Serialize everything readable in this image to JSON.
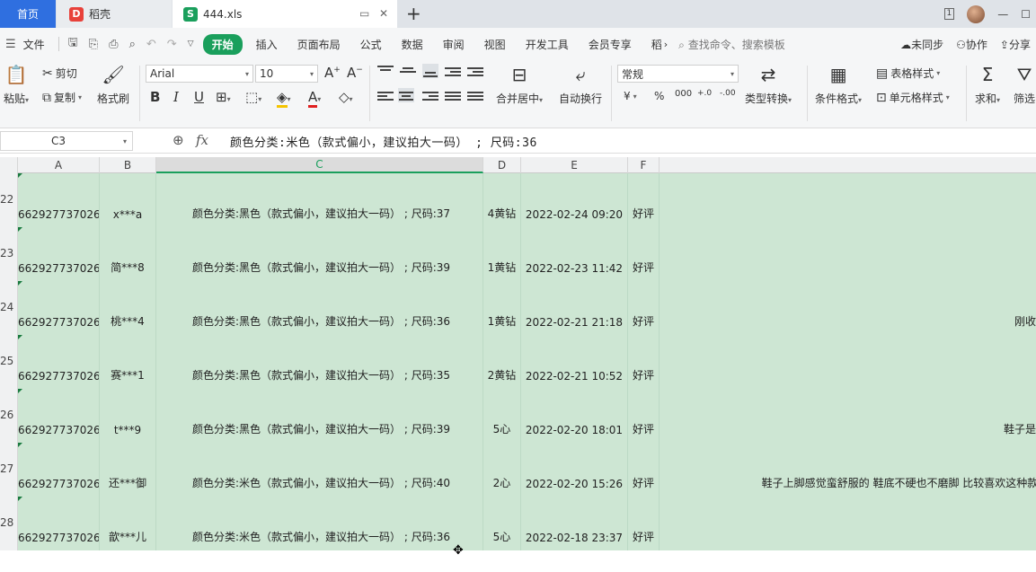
{
  "tabs": {
    "home": "首页",
    "daoke": "稻壳",
    "file": "444.xls",
    "daoke_icon": "D",
    "file_icon": "S"
  },
  "window": {
    "badge": "1"
  },
  "menu": {
    "file": "文件",
    "items": [
      "开始",
      "插入",
      "页面布局",
      "公式",
      "数据",
      "审阅",
      "视图",
      "开发工具",
      "会员专享",
      "稻"
    ],
    "search": "查找命令、搜索模板",
    "sync": "未同步",
    "collab": "协作",
    "share": "分享"
  },
  "ribbon": {
    "paste": "粘贴",
    "cut": "剪切",
    "copy": "复制",
    "format_painter": "格式刷",
    "font_name": "Arial",
    "font_size": "10",
    "merge_center": "合并居中",
    "wrap_text": "自动换行",
    "number_format": "常规",
    "type_convert": "类型转换",
    "conditional_format": "条件格式",
    "table_style": "表格样式",
    "cell_style": "单元格样式",
    "sum": "求和",
    "filter": "筛选",
    "bold": "B",
    "italic": "I",
    "underline": "U",
    "font_grow": "A",
    "font_shrink": "A",
    "currency": "¥",
    "percent": "%",
    "thousands": "000",
    "inc_decimal": "+.0",
    "dec_decimal": "-.00"
  },
  "formula_bar": {
    "cell_ref": "C3",
    "fx": "fx",
    "content": "颜色分类:米色（款式偏小，建议拍大一码）  ;  尺码:36"
  },
  "columns": [
    "A",
    "B",
    "C",
    "D",
    "E",
    "F"
  ],
  "selected_column": "C",
  "rows": [
    {
      "num": "22",
      "a": "662927737026",
      "b": "x***a",
      "c": "颜色分类:黑色（款式偏小，建议拍大一码）  ;  尺码:37",
      "d": "4黄钻",
      "e": "2022-02-24 09:20",
      "f": "好评",
      "g": ""
    },
    {
      "num": "23",
      "a": "662927737026",
      "b": "简***8",
      "c": "颜色分类:黑色（款式偏小，建议拍大一码）  ;  尺码:39",
      "d": "1黄钻",
      "e": "2022-02-23 11:42",
      "f": "好评",
      "g": ""
    },
    {
      "num": "24",
      "a": "662927737026",
      "b": "桃***4",
      "c": "颜色分类:黑色（款式偏小，建议拍大一码）  ;  尺码:36",
      "d": "1黄钻",
      "e": "2022-02-21 21:18",
      "f": "好评",
      "g": "刚收"
    },
    {
      "num": "25",
      "a": "662927737026",
      "b": "赛***1",
      "c": "颜色分类:黑色（款式偏小，建议拍大一码）  ;  尺码:35",
      "d": "2黄钻",
      "e": "2022-02-21 10:52",
      "f": "好评",
      "g": ""
    },
    {
      "num": "26",
      "a": "662927737026",
      "b": "t***9",
      "c": "颜色分类:黑色（款式偏小，建议拍大一码）  ;  尺码:39",
      "d": "5心",
      "e": "2022-02-20 18:01",
      "f": "好评",
      "g": "鞋子是"
    },
    {
      "num": "27",
      "a": "662927737026",
      "b": "还***御",
      "c": "颜色分类:米色（款式偏小，建议拍大一码）  ;  尺码:40",
      "d": "2心",
      "e": "2022-02-20 15:26",
      "f": "好评",
      "g": "鞋子上脚感觉蛮舒服的 鞋底不硬也不磨脚 比较喜欢这种款式的"
    },
    {
      "num": "28",
      "a": "662927737026",
      "b": "歆***儿",
      "c": "颜色分类:米色（款式偏小，建议拍大一码）  ;  尺码:36",
      "d": "5心",
      "e": "2022-02-18 23:37",
      "f": "好评",
      "g": ""
    }
  ]
}
